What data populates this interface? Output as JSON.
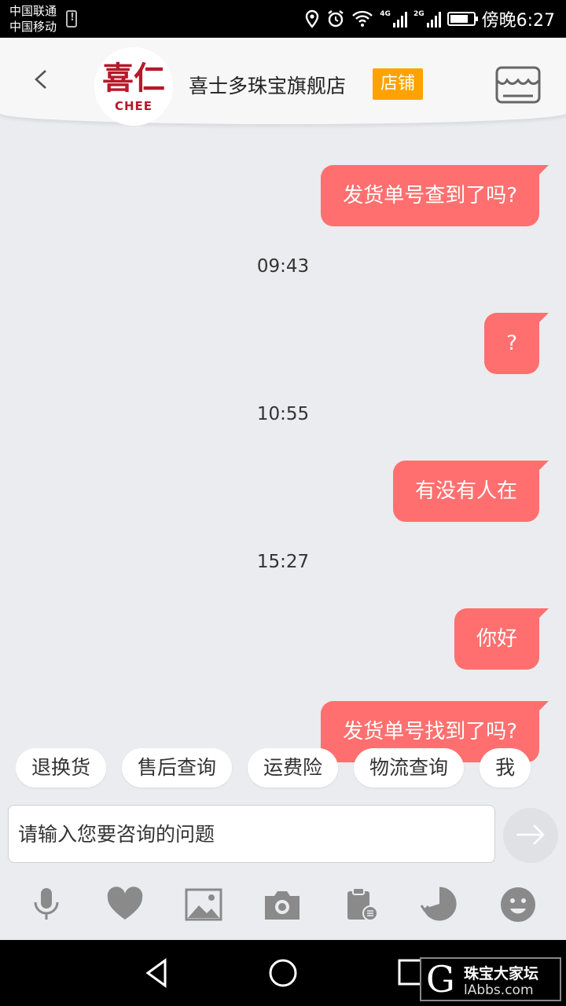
{
  "status_bar": {
    "carrier1": "中国联通",
    "carrier2": "中国移动",
    "net1": "4G",
    "net2": "2G",
    "time": "傍晚6:27"
  },
  "header": {
    "logo_text": "喜仁",
    "logo_sub": "CHEE",
    "shop_name": "喜士多珠宝旗舰店",
    "shop_tag": "店铺"
  },
  "messages": [
    {
      "type": "bubble",
      "text": "发货单号查到了吗?"
    },
    {
      "type": "time",
      "text": "09:43"
    },
    {
      "type": "bubble",
      "text": "?"
    },
    {
      "type": "time",
      "text": "10:55"
    },
    {
      "type": "bubble",
      "text": "有没有人在"
    },
    {
      "type": "time",
      "text": "15:27"
    },
    {
      "type": "bubble",
      "text": "你好"
    },
    {
      "type": "bubble",
      "text": "发货单号找到了吗?"
    }
  ],
  "quick_replies": [
    "退换货",
    "售后查询",
    "运费险",
    "物流查询",
    "我"
  ],
  "input": {
    "placeholder": "请输入您要咨询的问题"
  },
  "toolbar_icons": [
    "microphone-icon",
    "heart-icon",
    "image-icon",
    "camera-icon",
    "order-clipboard-icon",
    "history-icon",
    "emoji-icon"
  ],
  "watermark": {
    "letter": "G",
    "cn": "珠宝大家坛",
    "en": "lAbbs.com"
  },
  "colors": {
    "bubble": "#ff6f6f",
    "shop_tag": "#ffa200",
    "icon_gray": "#8a8a8a"
  }
}
